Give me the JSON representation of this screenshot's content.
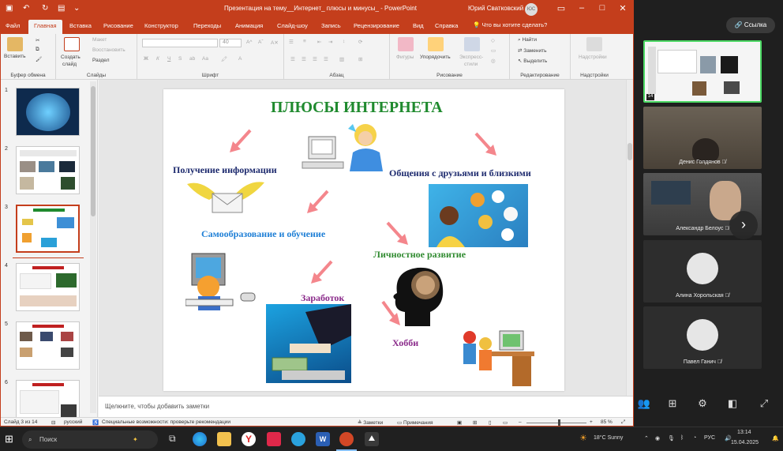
{
  "window": {
    "title": "Презентация на тему__Интернет_ плюсы и минусы_  -  PowerPoint",
    "user": "Юрий Сватковский",
    "user_initials": "ЮС"
  },
  "tabs": [
    "Файл",
    "Главная",
    "Вставка",
    "Рисование",
    "Конструктор",
    "Переходы",
    "Анимация",
    "Слайд-шоу",
    "Запись",
    "Рецензирование",
    "Вид",
    "Справка"
  ],
  "tell_me": "Что вы хотите сделать?",
  "ribbon": {
    "clipboard": {
      "paste": "Вставить",
      "label": "Буфер обмена"
    },
    "slides": {
      "new": "Создать",
      "new2": "слайд",
      "layout": "Макет",
      "reset": "Восстановить",
      "section": "Раздел",
      "label": "Слайды"
    },
    "font": {
      "size": "40",
      "label": "Шрифт"
    },
    "paragraph": {
      "label": "Абзац"
    },
    "drawing": {
      "shapes": "Фигуры",
      "arrange": "Упорядочить",
      "quick_styles": "Экспресс-",
      "quick_styles2": "стили",
      "label": "Рисование"
    },
    "editing": {
      "find": "Найти",
      "replace": "Заменить",
      "select": "Выделить",
      "label": "Редактирование"
    },
    "addins": {
      "item": "Надстройки",
      "label": "Надстройки"
    }
  },
  "thumbnails": [
    "1",
    "2",
    "3",
    "4",
    "5",
    "6"
  ],
  "slide": {
    "title": "ПЛЮСЫ ИНТЕРНЕТА",
    "labels": {
      "info": "Получение информации",
      "friends": "Общения с друзьями и близкими",
      "selfedu": "Самообразование и обучение",
      "growth": "Личностное развитие",
      "earning": "Заработок",
      "hobby": "Хобби"
    }
  },
  "notes_placeholder": "Щелкните, чтобы добавить заметки",
  "status": {
    "slide": "Слайд 3 из 14",
    "lang": "русский",
    "accessibility": "Специальные возможности: проверьте рекомендации",
    "notes": "Заметки",
    "comments": "Примечания",
    "zoom": "85 %"
  },
  "video": {
    "link_button": "Ссылка",
    "participants": [
      {
        "name": ""
      },
      {
        "name": "Денис Голдянов"
      },
      {
        "name": "Александр Белоус"
      },
      {
        "name": "Алина Хорольская"
      },
      {
        "name": "Павел Ганич"
      }
    ],
    "badge": "14"
  },
  "taskbar": {
    "search": "Поиск",
    "weather": "18°C  Sunny",
    "lang": "РУС",
    "time": "13:14",
    "date": "15.04.2025"
  },
  "colors": {
    "accent": "#c43e1c",
    "slide_title": "#1f8a2e",
    "arrow": "#f4868c",
    "blue_label": "#1e7fd6",
    "navy_label": "#1d2a6e",
    "green_label": "#2f8a2f",
    "purple_label": "#8a2a8a"
  }
}
